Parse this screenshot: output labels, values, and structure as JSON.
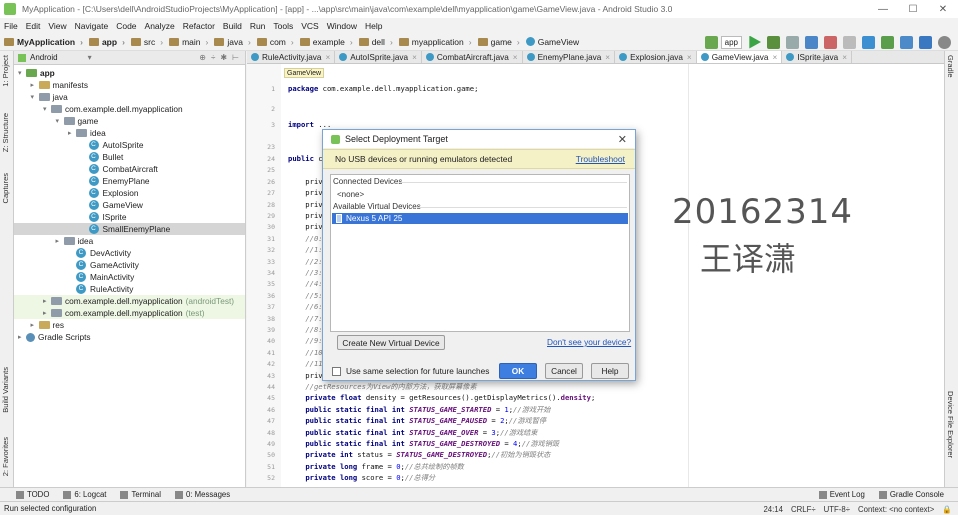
{
  "window": {
    "title": "MyApplication - [C:\\Users\\dell\\AndroidStudioProjects\\MyApplication] - [app] - ...\\app\\src\\main\\java\\com\\example\\dell\\myapplication\\game\\GameView.java - Android Studio 3.0"
  },
  "menu": [
    "File",
    "Edit",
    "View",
    "Navigate",
    "Code",
    "Analyze",
    "Refactor",
    "Build",
    "Run",
    "Tools",
    "VCS",
    "Window",
    "Help"
  ],
  "breadcrumbs": [
    "MyApplication",
    "app",
    "src",
    "main",
    "java",
    "com",
    "example",
    "dell",
    "myapplication",
    "game",
    "GameView"
  ],
  "toolbar": {
    "run_config": "app"
  },
  "left_tabs": [
    "1: Project",
    "Z: Structure",
    "Captures",
    "Build Variants",
    "2: Favorites"
  ],
  "right_tabs": [
    "Gradle",
    "Device File Explorer"
  ],
  "project": {
    "view": "Android",
    "rows": [
      {
        "label": "app",
        "depth": 0,
        "kind": "folder",
        "arrow": "▾",
        "bold": true
      },
      {
        "label": "manifests",
        "depth": 1,
        "kind": "folder",
        "arrow": "▸"
      },
      {
        "label": "java",
        "depth": 1,
        "kind": "folder",
        "arrow": "▾"
      },
      {
        "label": "com.example.dell.myapplication",
        "depth": 2,
        "kind": "folder",
        "arrow": "▾"
      },
      {
        "label": "game",
        "depth": 3,
        "kind": "folder",
        "arrow": "▾"
      },
      {
        "label": "idea",
        "depth": 4,
        "kind": "folder",
        "arrow": "▸"
      },
      {
        "label": "AutoISprite",
        "depth": 5,
        "kind": "class"
      },
      {
        "label": "Bullet",
        "depth": 5,
        "kind": "class"
      },
      {
        "label": "CombatAircraft",
        "depth": 5,
        "kind": "class"
      },
      {
        "label": "EnemyPlane",
        "depth": 5,
        "kind": "class"
      },
      {
        "label": "Explosion",
        "depth": 5,
        "kind": "class"
      },
      {
        "label": "GameView",
        "depth": 5,
        "kind": "class"
      },
      {
        "label": "ISprite",
        "depth": 5,
        "kind": "class"
      },
      {
        "label": "SmallEnemyPlane",
        "depth": 5,
        "kind": "class",
        "selected": true
      },
      {
        "label": "idea",
        "depth": 3,
        "kind": "folder",
        "arrow": "▸"
      },
      {
        "label": "DevActivity",
        "depth": 4,
        "kind": "class"
      },
      {
        "label": "GameActivity",
        "depth": 4,
        "kind": "class"
      },
      {
        "label": "MainActivity",
        "depth": 4,
        "kind": "class"
      },
      {
        "label": "RuleActivity",
        "depth": 4,
        "kind": "class"
      },
      {
        "label": "com.example.dell.myapplication",
        "suffix": "(androidTest)",
        "depth": 2,
        "kind": "folder",
        "arrow": "▸",
        "tinted": true
      },
      {
        "label": "com.example.dell.myapplication",
        "suffix": "(test)",
        "depth": 2,
        "kind": "folder",
        "arrow": "▸",
        "tinted": true
      },
      {
        "label": "res",
        "depth": 1,
        "kind": "folder",
        "arrow": "▸"
      },
      {
        "label": "Gradle Scripts",
        "depth": 0,
        "kind": "gradle",
        "arrow": "▸"
      }
    ]
  },
  "editor": {
    "tabs": [
      {
        "label": "RuleActivity.java",
        "active": false
      },
      {
        "label": "AutoISprite.java",
        "active": false
      },
      {
        "label": "CombatAircraft.java",
        "active": false
      },
      {
        "label": "EnemyPlane.java",
        "active": false
      },
      {
        "label": "Explosion.java",
        "active": false
      },
      {
        "label": "GameView.java",
        "active": true
      },
      {
        "label": "ISprite.java",
        "active": false
      }
    ],
    "breadcrumb_hint": "GameView",
    "lines": [
      {
        "n": "1",
        "code": "package com.example.dell.myapplication.game;"
      },
      {
        "n": "2",
        "code": ""
      },
      {
        "n": "3",
        "code": "import ..."
      },
      {
        "n": "23",
        "code": ""
      },
      {
        "n": "24",
        "code": "public c"
      },
      {
        "n": "25",
        "code": ""
      },
      {
        "n": "26",
        "code": "    priv"
      },
      {
        "n": "27",
        "code": "    priv"
      },
      {
        "n": "28",
        "code": "    priv"
      },
      {
        "n": "29",
        "code": "    priv"
      },
      {
        "n": "30",
        "code": "    priv"
      },
      {
        "n": "31",
        "code": "    //0:"
      },
      {
        "n": "32",
        "code": "    //1:"
      },
      {
        "n": "33",
        "code": "    //2:"
      },
      {
        "n": "34",
        "code": "    //3:"
      },
      {
        "n": "35",
        "code": "    //4:"
      },
      {
        "n": "36",
        "code": "    //5:"
      },
      {
        "n": "37",
        "code": "    //6:"
      },
      {
        "n": "38",
        "code": "    //7:"
      },
      {
        "n": "39",
        "code": "    //8:"
      },
      {
        "n": "40",
        "code": "    //9:"
      },
      {
        "n": "41",
        "code": "    //10"
      },
      {
        "n": "42",
        "code": "    //11"
      },
      {
        "n": "43",
        "code": "    priv"
      },
      {
        "n": "44",
        "code": "    //getResources为View的内部方法，获取屏幕像素"
      },
      {
        "n": "45",
        "code": "    private float density = getResources().getDisplayMetrics().density;"
      },
      {
        "n": "46",
        "code": "    public static final int STATUS_GAME_STARTED = 1;//游戏开始"
      },
      {
        "n": "47",
        "code": "    public static final int STATUS_GAME_PAUSED = 2;//游戏暂停"
      },
      {
        "n": "48",
        "code": "    public static final int STATUS_GAME_OVER = 3;//游戏结束"
      },
      {
        "n": "49",
        "code": "    public static final int STATUS_GAME_DESTROYED = 4;//游戏销毁"
      },
      {
        "n": "50",
        "code": "    private int status = STATUS_GAME_DESTROYED;//初始为销毁状态"
      },
      {
        "n": "51",
        "code": "    private long frame = 0;//总共绘制的帧数"
      },
      {
        "n": "52",
        "code": "    private long score = 0;//总得分"
      }
    ]
  },
  "watermark": {
    "line1": "20162314",
    "line2": "王译潇"
  },
  "dialog": {
    "title": "Select Deployment Target",
    "warning": "No USB devices or running emulators detected",
    "troubleshoot": "Troubleshoot",
    "connected_header": "Connected Devices",
    "connected_none": "<none>",
    "virtual_header": "Available Virtual Devices",
    "virtual_device": "Nexus 5 API 25",
    "create_button": "Create New Virtual Device",
    "dont_see_link": "Don't see your device?",
    "checkbox_label": "Use same selection for future launches",
    "checkbox_checked": false,
    "ok": "OK",
    "cancel": "Cancel",
    "help": "Help"
  },
  "tool_windows": [
    "TODO",
    "6: Logcat",
    "Terminal",
    "0: Messages",
    "Event Log",
    "Gradle Console"
  ],
  "status": {
    "message": "Run selected configuration",
    "position": "24:14",
    "line_sep": "CRLF÷",
    "encoding": "UTF-8÷",
    "context": "Context: <no context>"
  },
  "colors": {
    "accent": "#3875d7",
    "selection_row": "#d5d5d5",
    "warning_bg": "#f5f1c7",
    "link": "#2255bb"
  }
}
